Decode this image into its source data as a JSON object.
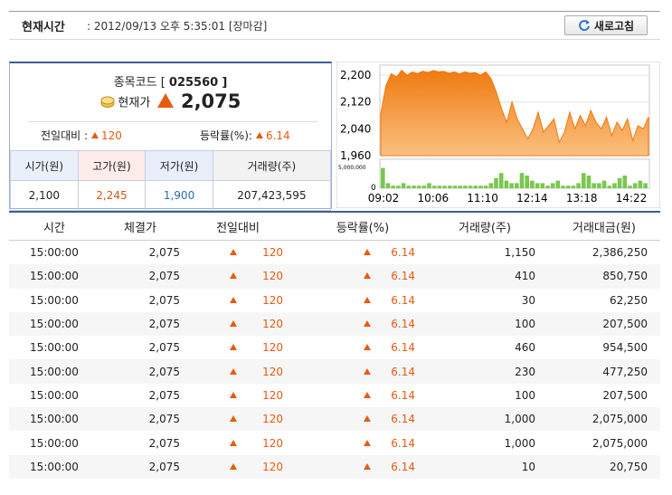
{
  "header": {
    "label": "현재시간",
    "separator": ":",
    "datetime": "2012/09/13 오후 5:35:01 [장마감]",
    "refresh_label": "새로고침"
  },
  "quote": {
    "code_prefix": "종목코드 [",
    "code": "025560",
    "code_suffix": "]",
    "price_label": "현재가",
    "price": "2,075",
    "change_label": "전일대비 :",
    "change": "120",
    "rate_label": "등락률(%):",
    "rate": "6.14"
  },
  "ohlc": {
    "headers": [
      "시가(원)",
      "고가(원)",
      "저가(원)",
      "거래량(주)"
    ],
    "values": [
      "2,100",
      "2,245",
      "1,900",
      "207,423,595"
    ]
  },
  "chart_data": {
    "type": "area",
    "title": "",
    "xlabel": "",
    "ylabel": "",
    "x_ticks": [
      "09:02",
      "10:06",
      "11:10",
      "12:14",
      "13:18",
      "14:22"
    ],
    "y_ticks": [
      "2,200",
      "2,120",
      "2,040",
      "1,960"
    ],
    "ylim": [
      1960,
      2230
    ],
    "volume_tick": "5,000,000",
    "volume_zero": "0",
    "series": [
      {
        "values": [
          2085,
          2170,
          2205,
          2195,
          2215,
          2200,
          2210,
          2205,
          2212,
          2208,
          2214,
          2210,
          2212,
          2206,
          2210,
          2204,
          2210,
          2206,
          2208,
          2200,
          2210,
          2190,
          2150,
          2100,
          2060,
          2120,
          2070,
          2040,
          2010,
          2040,
          2090,
          2030,
          2050,
          2070,
          2000,
          2030,
          2090,
          2040,
          2080,
          2050,
          2095,
          2060,
          2040,
          2075,
          2020,
          2060,
          2035,
          2070,
          2005,
          2050,
          2040,
          2075
        ],
        "color": "#f07a10"
      },
      {
        "values": [
          8,
          2,
          1,
          1,
          2,
          1,
          1,
          1,
          1,
          2,
          1,
          1,
          1,
          1,
          1,
          1,
          1,
          1,
          1,
          1,
          1,
          2,
          4,
          6,
          3,
          2,
          2,
          6,
          5,
          3,
          2,
          2,
          1,
          2,
          3,
          1,
          1,
          1,
          2,
          6,
          5,
          2,
          2,
          3,
          1,
          2,
          4,
          5,
          1,
          2,
          3,
          2
        ],
        "color": "#7ac74f"
      }
    ]
  },
  "table": {
    "headers": [
      "시간",
      "체결가",
      "전일대비",
      "등락률(%)",
      "거래량(주)",
      "거래대금(원)"
    ],
    "rows": [
      [
        "15:00:00",
        "2,075",
        "120",
        "6.14",
        "1,150",
        "2,386,250"
      ],
      [
        "15:00:00",
        "2,075",
        "120",
        "6.14",
        "410",
        "850,750"
      ],
      [
        "15:00:00",
        "2,075",
        "120",
        "6.14",
        "30",
        "62,250"
      ],
      [
        "15:00:00",
        "2,075",
        "120",
        "6.14",
        "100",
        "207,500"
      ],
      [
        "15:00:00",
        "2,075",
        "120",
        "6.14",
        "460",
        "954,500"
      ],
      [
        "15:00:00",
        "2,075",
        "120",
        "6.14",
        "230",
        "477,250"
      ],
      [
        "15:00:00",
        "2,075",
        "120",
        "6.14",
        "100",
        "207,500"
      ],
      [
        "15:00:00",
        "2,075",
        "120",
        "6.14",
        "1,000",
        "2,075,000"
      ],
      [
        "15:00:00",
        "2,075",
        "120",
        "6.14",
        "1,000",
        "2,075,000"
      ],
      [
        "15:00:00",
        "2,075",
        "120",
        "6.14",
        "10",
        "20,750"
      ]
    ]
  },
  "colors": {
    "accent": "#3b5f9a",
    "up": "#e85a10",
    "high": "#d0561a",
    "low": "#2a6ab2"
  }
}
